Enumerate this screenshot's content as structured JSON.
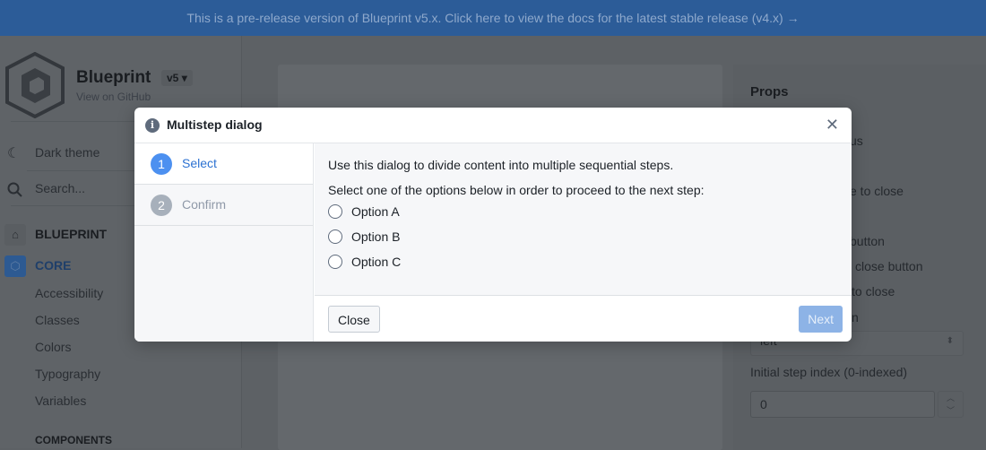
{
  "banner": {
    "text": "This is a pre-release version of Blueprint v5.x. Click here to view the docs for the latest stable release (v4.x) →"
  },
  "sidebar": {
    "brand": "Blueprint",
    "version": "v5",
    "github": "View on GitHub",
    "dark_theme": "Dark theme",
    "search_placeholder": "Search...",
    "sections": [
      {
        "label": "BLUEPRINT",
        "icon": "home-icon"
      },
      {
        "label": "CORE",
        "icon": "core-icon"
      }
    ],
    "items": [
      "Accessibility",
      "Classes",
      "Colors",
      "Typography",
      "Variables"
    ],
    "components_heading": "COMPONENTS"
  },
  "props": {
    "title": "Props",
    "fragments": [
      "us",
      "e to close",
      "button",
      "close button",
      "to close",
      "n"
    ],
    "select_value": "left",
    "step_index_label": "Initial step index (0-indexed)",
    "step_index_value": "0"
  },
  "dialog": {
    "title": "Multistep dialog",
    "steps": [
      {
        "num": "1",
        "label": "Select"
      },
      {
        "num": "2",
        "label": "Confirm"
      }
    ],
    "intro": "Use this dialog to divide content into multiple sequential steps.",
    "instruction": "Select one of the options below in order to proceed to the next step:",
    "options": [
      "Option A",
      "Option B",
      "Option C"
    ],
    "close_label": "Close",
    "next_label": "Next",
    "active_color": "#4c90f0",
    "inactive_color": "#a7b0bb"
  }
}
